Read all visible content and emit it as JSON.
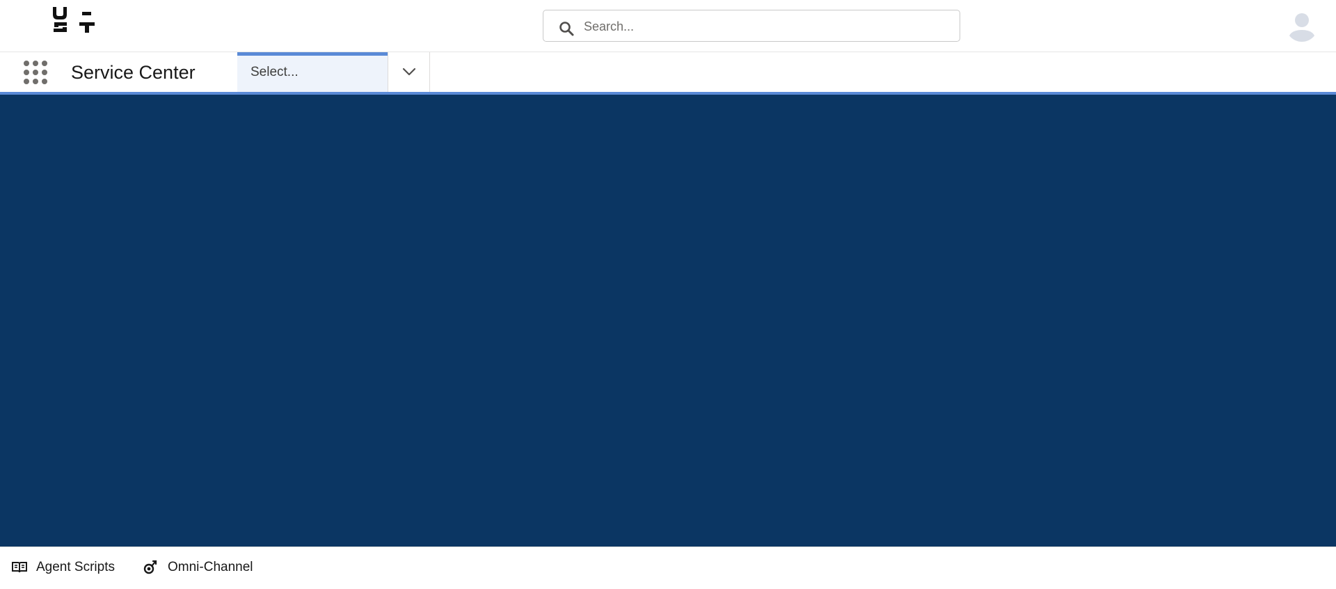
{
  "header": {
    "logo_text": "U-ST",
    "search": {
      "placeholder": "Search...",
      "value": ""
    }
  },
  "nav": {
    "app_name": "Service Center",
    "select_label": "Select..."
  },
  "utility_bar": {
    "items": [
      {
        "label": "Agent Scripts",
        "icon": "book-icon"
      },
      {
        "label": "Omni-Channel",
        "icon": "omni-channel-icon"
      }
    ]
  },
  "colors": {
    "workspace_background": "#0b3663",
    "accent": "#5a8ad6",
    "select_background": "#eef3fb"
  }
}
